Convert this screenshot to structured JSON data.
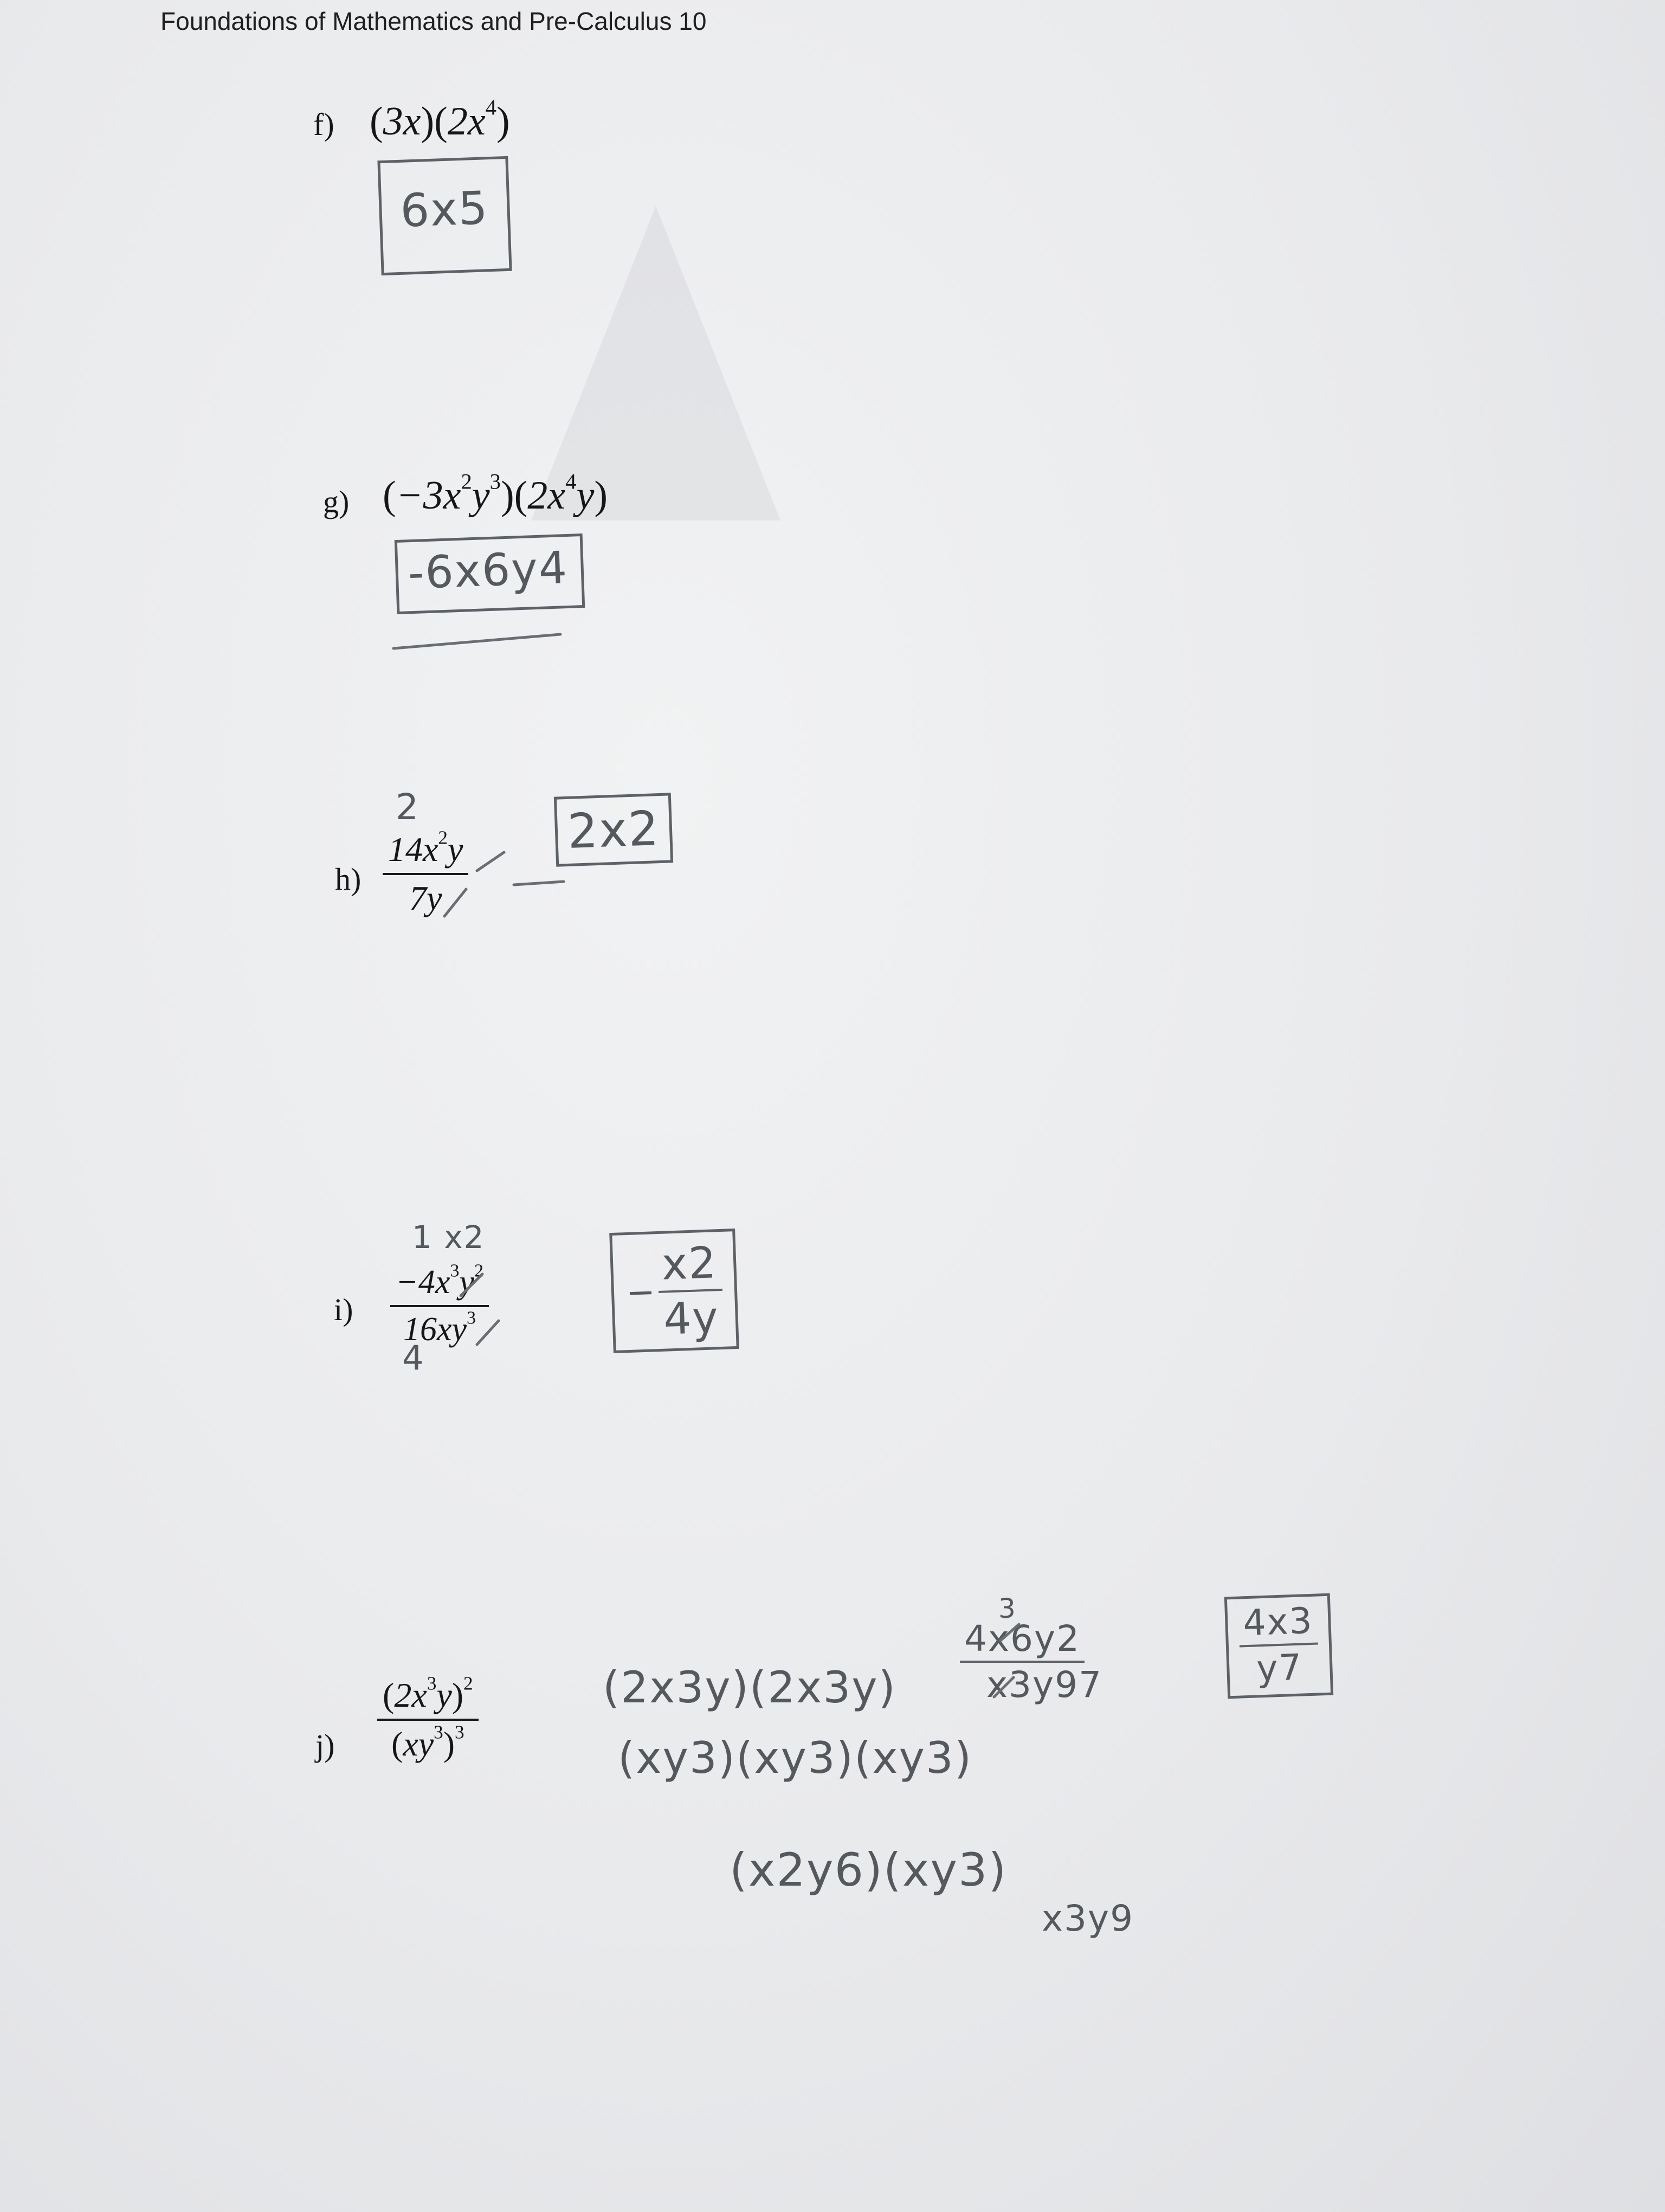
{
  "header": {
    "title": "Foundations of Mathematics and Pre-Calculus 10"
  },
  "questions": {
    "f": {
      "label": "f)",
      "answer": "6x5"
    },
    "g": {
      "label": "g)",
      "answer": "-6x6y4"
    },
    "h": {
      "label": "h)",
      "note": "2",
      "answer": "2x2"
    },
    "i": {
      "label": "i)",
      "note_top": "1  x2",
      "note_bottom": "4",
      "answer_num": "x2",
      "answer_den": "4y"
    },
    "j": {
      "label": "j)",
      "work_line1": "(2x3y)(2x3y)",
      "work_line2": "(xy3)(xy3)(xy3)",
      "work_line3": "(x2y6)(xy3)",
      "work_num": "4x6y2",
      "work_den": "x3y97",
      "work_note": "3",
      "work_den2": "x3y9",
      "answer_num": "4x3",
      "answer_den": "y7"
    }
  }
}
